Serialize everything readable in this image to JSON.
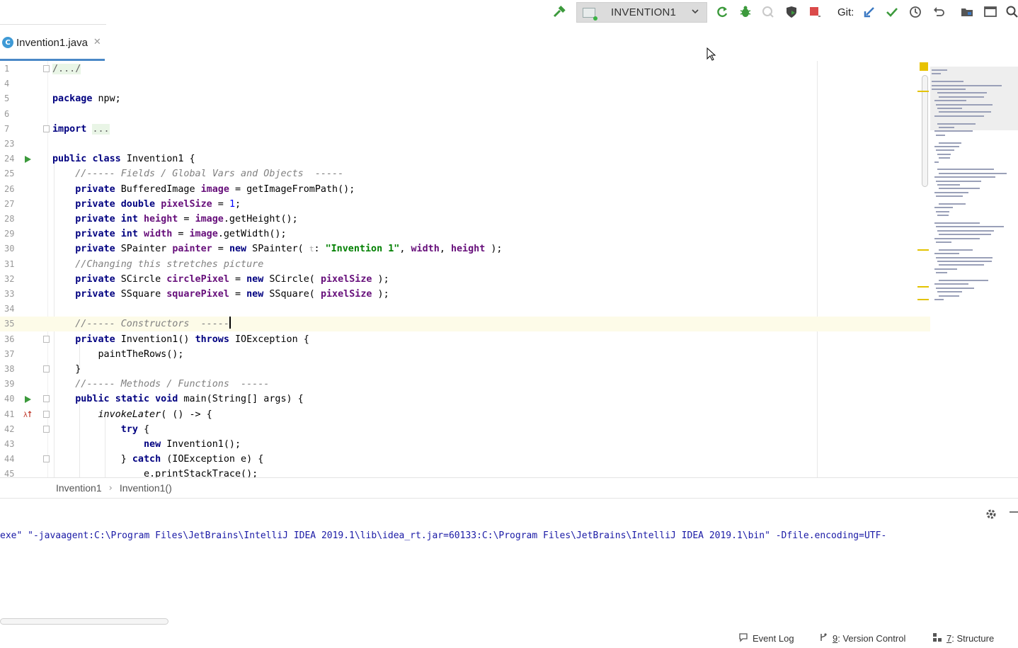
{
  "toolbar": {
    "run_config": "INVENTION1",
    "git_label": "Git:"
  },
  "tab": {
    "icon_letter": "C",
    "name": "Invention1.java",
    "close": "✕"
  },
  "editor": {
    "caret_line": "35",
    "lines": [
      {
        "n": "1",
        "gi": "",
        "fold": true,
        "code": "/.../",
        "type": "folded"
      },
      {
        "n": "4",
        "code": ""
      },
      {
        "n": "5",
        "code": "package npw;"
      },
      {
        "n": "6",
        "code": ""
      },
      {
        "n": "7",
        "fold": true,
        "code": "import ..."
      },
      {
        "n": "23",
        "code": ""
      },
      {
        "n": "24",
        "gi": "run",
        "code": "public class Invention1 {"
      },
      {
        "n": "25",
        "code": "    //----- Fields / Global Vars and Objects  -----"
      },
      {
        "n": "26",
        "code": "    private BufferedImage image = getImageFromPath();"
      },
      {
        "n": "27",
        "code": "    private double pixelSize = 1;"
      },
      {
        "n": "28",
        "code": "    private int height = image.getHeight();"
      },
      {
        "n": "29",
        "code": "    private int width = image.getWidth();"
      },
      {
        "n": "30",
        "code": "    private SPainter painter = new SPainter( t: \"Invention 1\", width, height );"
      },
      {
        "n": "31",
        "code": "    //Changing this stretches picture"
      },
      {
        "n": "32",
        "code": "    private SCircle circlePixel = new SCircle( pixelSize );"
      },
      {
        "n": "33",
        "code": "    private SSquare squarePixel = new SSquare( pixelSize );"
      },
      {
        "n": "34",
        "code": ""
      },
      {
        "n": "35",
        "code": "    //----- Constructors  -----"
      },
      {
        "n": "36",
        "fold": true,
        "code": "    private Invention1() throws IOException {"
      },
      {
        "n": "37",
        "code": "        paintTheRows();"
      },
      {
        "n": "38",
        "fold": true,
        "code": "    }"
      },
      {
        "n": "39",
        "code": "    //----- Methods / Functions  -----"
      },
      {
        "n": "40",
        "gi": "run",
        "fold": true,
        "code": "    public static void main(String[] args) {"
      },
      {
        "n": "41",
        "gi": "lambda",
        "fold": true,
        "code": "        invokeLater( () -> {"
      },
      {
        "n": "42",
        "fold": true,
        "code": "            try {"
      },
      {
        "n": "43",
        "code": "                new Invention1();"
      },
      {
        "n": "44",
        "fold": true,
        "code": "            } catch (IOException e) {"
      },
      {
        "n": "45",
        "code": "                e.printStackTrace();"
      }
    ]
  },
  "breadcrumbs": [
    "Invention1",
    "Invention1()"
  ],
  "console": {
    "output": "exe\" \"-javaagent:C:\\Program Files\\JetBrains\\IntelliJ IDEA 2019.1\\lib\\idea_rt.jar=60133:C:\\Program Files\\JetBrains\\IntelliJ IDEA 2019.1\\bin\" -Dfile.encoding=UTF-"
  },
  "statusbar": {
    "event_log": "Event Log",
    "vc_num": "9",
    "vc_label": ": Version Control",
    "structure_num": "7",
    "structure_label": ": Structure"
  },
  "colors": {
    "keyword": "#000080",
    "field": "#660e7a",
    "string": "#008000",
    "comment": "#808080",
    "tab_underline": "#4a88c7"
  }
}
